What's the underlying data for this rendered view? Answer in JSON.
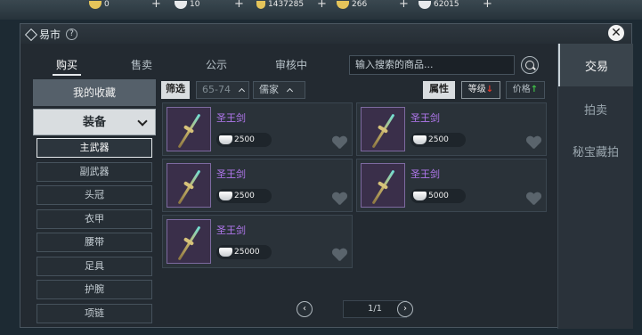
{
  "currency": [
    {
      "icon": "gold-ingot-icon",
      "value": "0"
    },
    {
      "icon": "silver-ingot-icon",
      "value": "10"
    },
    {
      "icon": "coin-icon",
      "value": "1437285"
    },
    {
      "icon": "gold-ingot-icon",
      "value": "266"
    },
    {
      "icon": "silver-ingot-icon",
      "value": "62015"
    }
  ],
  "window": {
    "title": "易市",
    "help": "?",
    "close": "✕"
  },
  "tabs": [
    "购买",
    "售卖",
    "公示",
    "审核中"
  ],
  "search": {
    "placeholder": "输入搜索的商品..."
  },
  "right_nav": [
    "交易",
    "拍卖",
    "秘宝藏拍"
  ],
  "left": {
    "favorites": "我的收藏",
    "category": "装备",
    "subcategories": [
      "主武器",
      "副武器",
      "头冠",
      "衣甲",
      "腰带",
      "足具",
      "护腕",
      "项链"
    ]
  },
  "filters": {
    "screen": "筛选",
    "level": "65-74",
    "school": "儒家"
  },
  "sort": {
    "attr": "属性",
    "grade": "等级",
    "grade_arrow": "↓",
    "price": "价格",
    "price_arrow": "↑"
  },
  "items": [
    {
      "name": "圣王剑",
      "price": "2500"
    },
    {
      "name": "圣王剑",
      "price": "2500"
    },
    {
      "name": "圣王剑",
      "price": "2500"
    },
    {
      "name": "圣王剑",
      "price": "5000"
    },
    {
      "name": "圣王剑",
      "price": "25000"
    }
  ],
  "pager": {
    "prev": "‹",
    "page": "1/1",
    "next": "›"
  },
  "colors": {
    "item_name": "#b278ef",
    "arrow_down": "#e2382a",
    "arrow_up": "#3fbf46"
  }
}
